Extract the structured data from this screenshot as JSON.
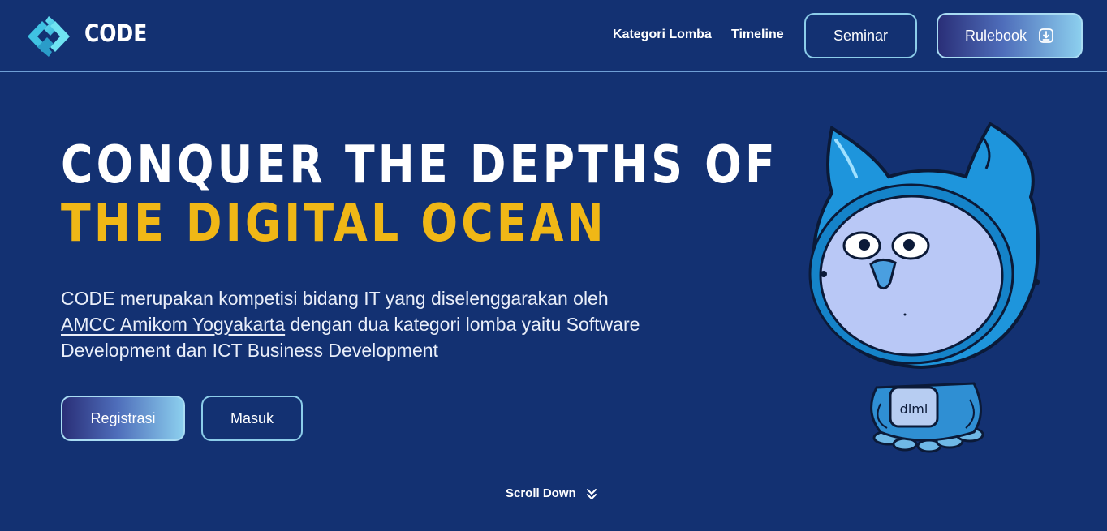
{
  "brand": {
    "name": "CODE",
    "logo_icon": "code-diamond-logo-icon"
  },
  "nav": {
    "kategori_label": "Kategori Lomba",
    "timeline_label": "Timeline",
    "seminar_label": "Seminar",
    "rulebook_label": "Rulebook",
    "rulebook_icon": "download-icon"
  },
  "hero": {
    "title_line1": "CONQUER THE DEPTHS OF",
    "title_line2": "THE DIGITAL OCEAN",
    "desc_part1": "CODE merupakan kompetisi bidang IT yang diselenggarakan oleh ",
    "desc_link": "AMCC Amikom Yogyakarta",
    "desc_part2": " dengan dua kategori lomba yaitu Software Development dan ICT Business Development",
    "registrasi_label": "Registrasi",
    "masuk_label": "Masuk",
    "scroll_label": "Scroll Down",
    "scroll_icon": "double-chevron-down-icon",
    "mascot": "owl-astronaut-mascot",
    "mascot_badge_text": "dlml"
  },
  "colors": {
    "background": "#133172",
    "accent_yellow": "#f0b716",
    "button_border": "#8ccde9"
  }
}
